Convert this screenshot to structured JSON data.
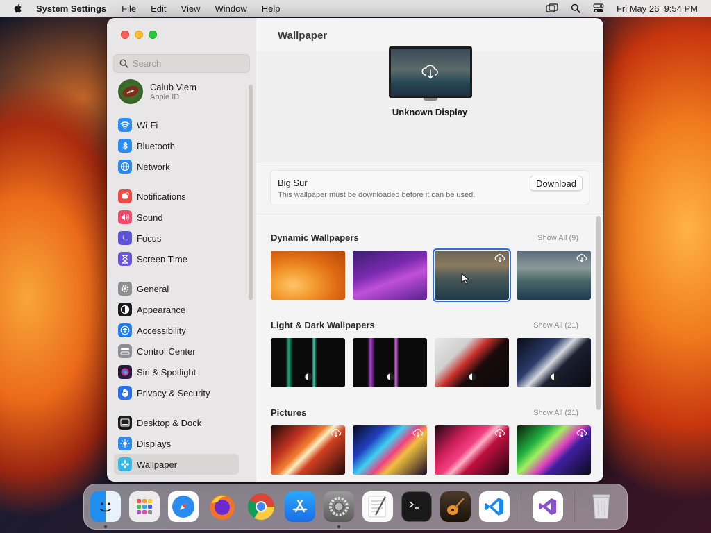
{
  "menubar": {
    "app_name": "System Settings",
    "items": [
      "File",
      "Edit",
      "View",
      "Window",
      "Help"
    ],
    "datetime": "Fri May 26  9:54 PM"
  },
  "sidebar": {
    "search_placeholder": "Search",
    "profile": {
      "name": "Calub Viem",
      "subtitle": "Apple ID"
    },
    "groups": [
      [
        {
          "label": "Wi-Fi",
          "icon": "wifi-icon",
          "color": "#2a8cf0"
        },
        {
          "label": "Bluetooth",
          "icon": "bluetooth-icon",
          "color": "#2a8cf0"
        },
        {
          "label": "Network",
          "icon": "globe-icon",
          "color": "#2a8cf0"
        }
      ],
      [
        {
          "label": "Notifications",
          "icon": "bell-icon",
          "color": "#ef4a42"
        },
        {
          "label": "Sound",
          "icon": "speaker-icon",
          "color": "#ef4a6a"
        },
        {
          "label": "Focus",
          "icon": "moon-icon",
          "color": "#5b54d6"
        },
        {
          "label": "Screen Time",
          "icon": "hourglass-icon",
          "color": "#6a55d8"
        }
      ],
      [
        {
          "label": "General",
          "icon": "gear-icon",
          "color": "#8e8e93"
        },
        {
          "label": "Appearance",
          "icon": "appearance-icon",
          "color": "#1c1c1e"
        },
        {
          "label": "Accessibility",
          "icon": "accessibility-icon",
          "color": "#1e7ef0"
        },
        {
          "label": "Control Center",
          "icon": "control-center-icon",
          "color": "#8e8e93"
        },
        {
          "label": "Siri & Spotlight",
          "icon": "siri-icon",
          "color": "#c2338f"
        },
        {
          "label": "Privacy & Security",
          "icon": "hand-icon",
          "color": "#2a6ee8"
        }
      ],
      [
        {
          "label": "Desktop & Dock",
          "icon": "dock-icon",
          "color": "#1c1c1e"
        },
        {
          "label": "Displays",
          "icon": "sun-icon",
          "color": "#2a8cf0"
        },
        {
          "label": "Wallpaper",
          "icon": "wallpaper-icon",
          "color": "#35b7e8",
          "selected": true
        }
      ]
    ]
  },
  "main": {
    "title": "Wallpaper",
    "display_name": "Unknown Display",
    "notice": {
      "title": "Big Sur",
      "text": "This wallpaper must be downloaded before it can be used.",
      "button": "Download"
    },
    "sections": [
      {
        "title": "Dynamic Wallpapers",
        "show_all": "Show All (9)"
      },
      {
        "title": "Light & Dark Wallpapers",
        "show_all": "Show All (21)"
      },
      {
        "title": "Pictures",
        "show_all": "Show All (21)"
      }
    ]
  },
  "dock": {
    "apps": [
      "Finder",
      "Launchpad",
      "Safari",
      "Firefox",
      "Chrome",
      "App Store",
      "System Settings",
      "TextEdit",
      "Terminal",
      "GarageBand",
      "Visual Studio Code",
      "Visual Studio",
      "Trash"
    ]
  }
}
